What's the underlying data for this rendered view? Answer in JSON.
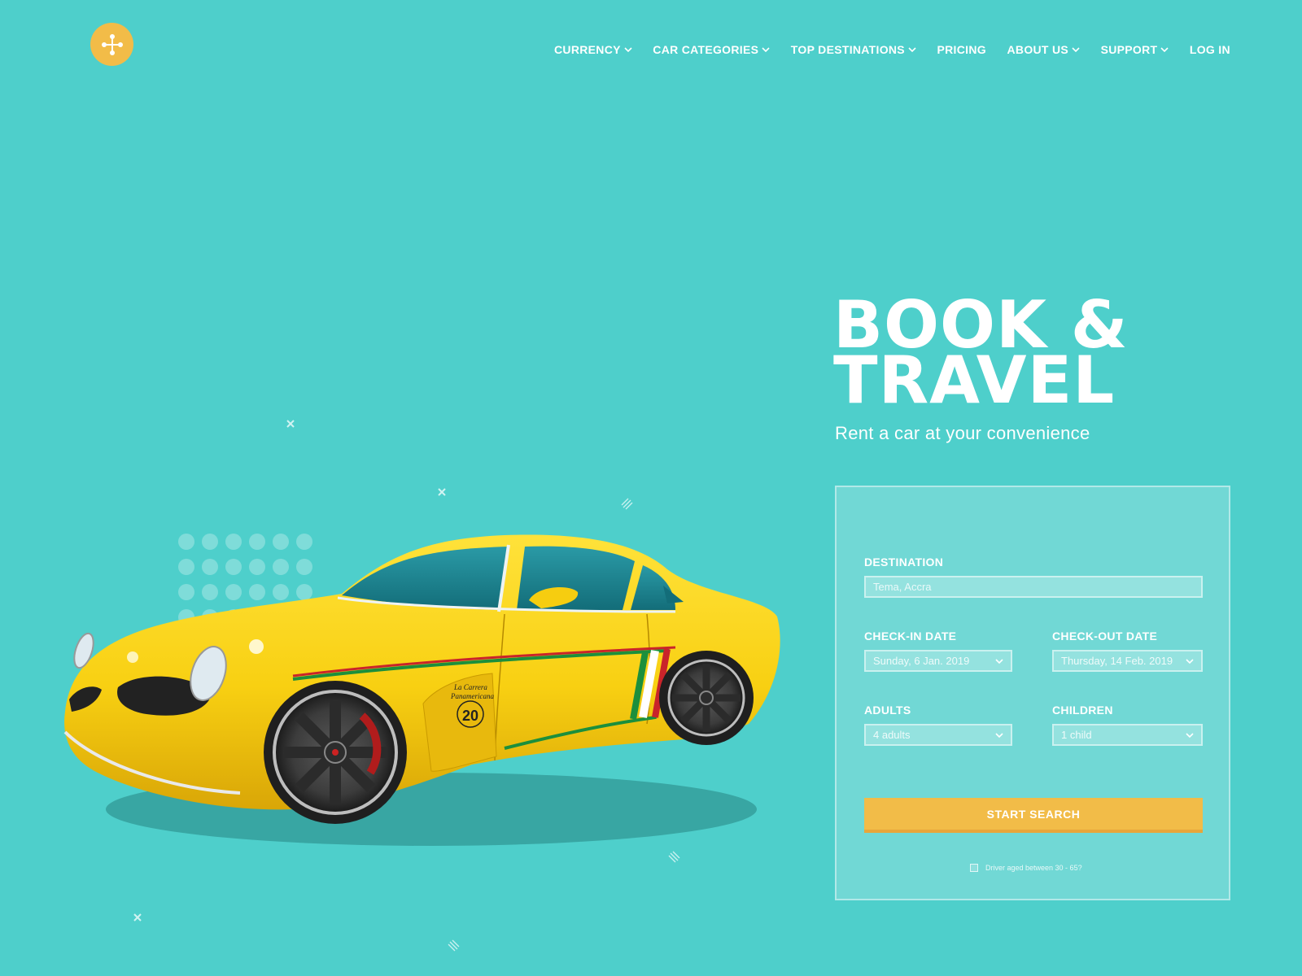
{
  "colors": {
    "background": "#4ecfcb",
    "accent": "#f2bc48",
    "text": "#ffffff"
  },
  "logo": {
    "icon": "cross-dots-icon"
  },
  "nav": {
    "items": [
      {
        "label": "CURRENCY",
        "dropdown": true
      },
      {
        "label": "CAR CATEGORIES",
        "dropdown": true
      },
      {
        "label": "TOP DESTINATIONS",
        "dropdown": true
      },
      {
        "label": "PRICING",
        "dropdown": false
      },
      {
        "label": "ABOUT US",
        "dropdown": true
      },
      {
        "label": "SUPPORT",
        "dropdown": true
      },
      {
        "label": "LOG IN",
        "dropdown": false
      }
    ]
  },
  "hero": {
    "title_line1": "BOOK &",
    "title_line2": "TRAVEL",
    "subtitle": "Rent a car at your convenience"
  },
  "form": {
    "destination": {
      "label": "DESTINATION",
      "placeholder": "Tema, Accra"
    },
    "checkin": {
      "label": "CHECK-IN DATE",
      "value": "Sunday, 6 Jan. 2019"
    },
    "checkout": {
      "label": "CHECK-OUT DATE",
      "value": "Thursday, 14 Feb. 2019"
    },
    "adults": {
      "label": "ADULTS",
      "value": "4 adults"
    },
    "children": {
      "label": "CHILDREN",
      "value": "1 child"
    },
    "submit_label": "START SEARCH",
    "driver_age_label": "Driver aged between 30 - 65?"
  },
  "car": {
    "decal_line1": "La Carrera",
    "decal_line2": "Panamericana",
    "decal_number": "20"
  }
}
